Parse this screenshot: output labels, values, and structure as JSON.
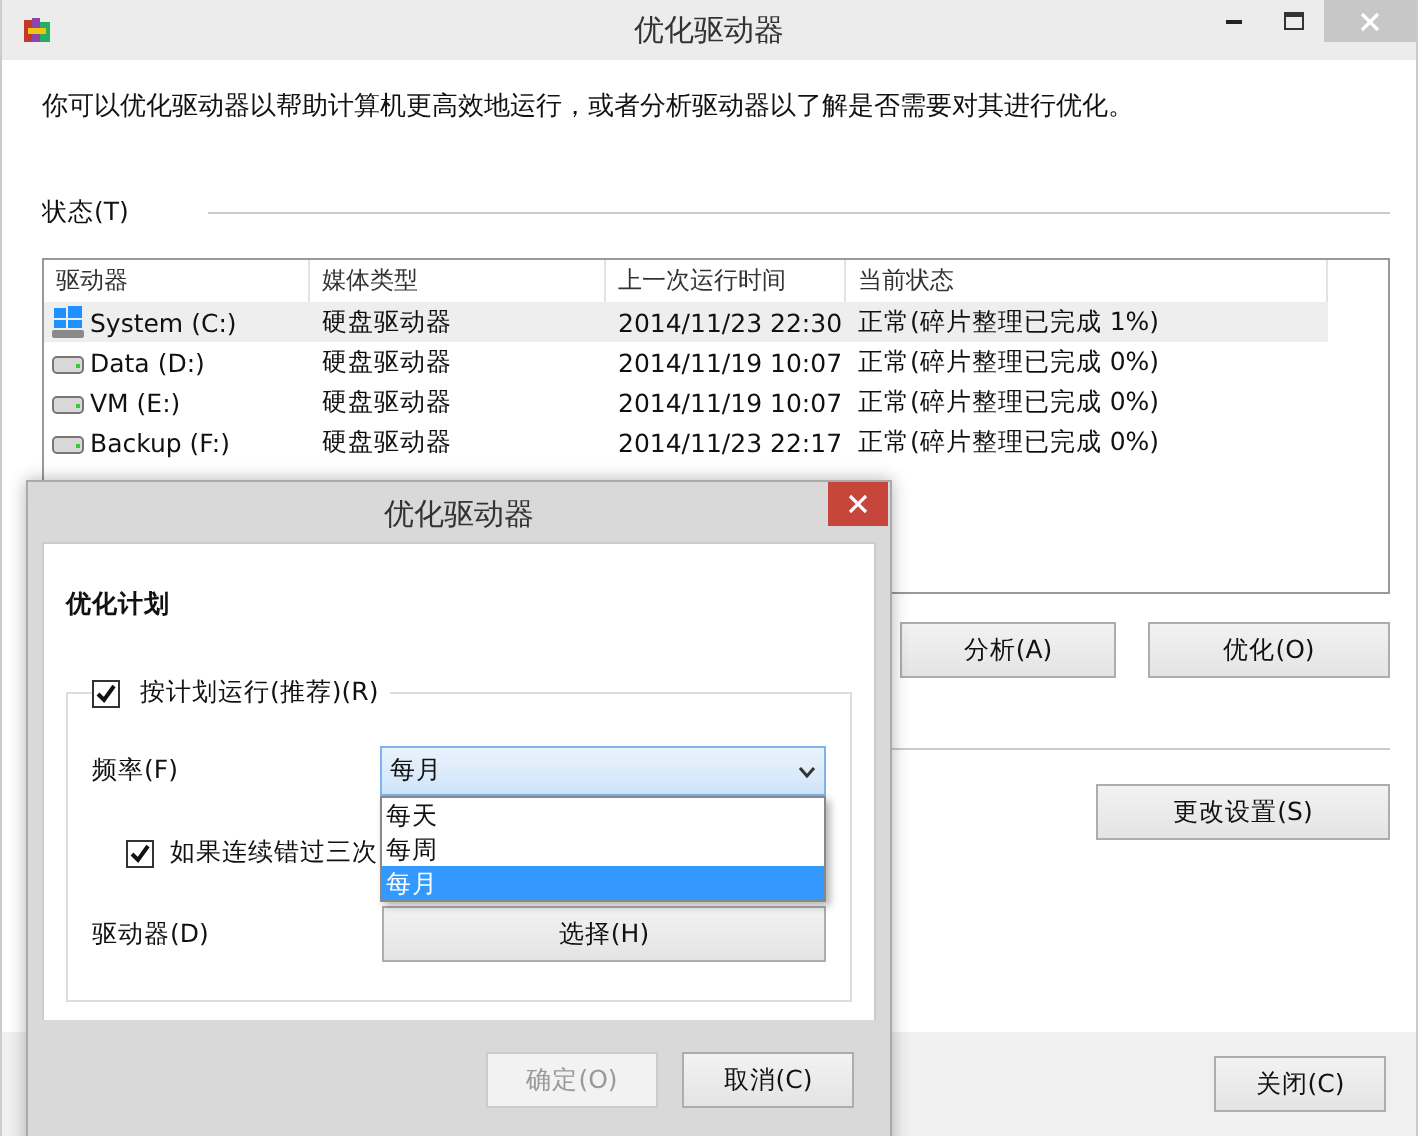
{
  "window": {
    "title": "优化驱动器"
  },
  "description": "你可以优化驱动器以帮助计算机更高效地运行，或者分析驱动器以了解是否需要对其进行优化。",
  "status_label": "状态(T)",
  "table": {
    "columns": [
      "驱动器",
      "媒体类型",
      "上一次运行时间",
      "当前状态"
    ],
    "rows": [
      {
        "drive": "System (C:)",
        "kind": "system",
        "media": "硬盘驱动器",
        "last_run": "2014/11/23 22:30",
        "status": "正常(碎片整理已完成 1%)",
        "selected": true
      },
      {
        "drive": "Data (D:)",
        "kind": "disk",
        "media": "硬盘驱动器",
        "last_run": "2014/11/19 10:07",
        "status": "正常(碎片整理已完成 0%)",
        "selected": false
      },
      {
        "drive": "VM (E:)",
        "kind": "disk",
        "media": "硬盘驱动器",
        "last_run": "2014/11/19 10:07",
        "status": "正常(碎片整理已完成 0%)",
        "selected": false
      },
      {
        "drive": "Backup (F:)",
        "kind": "disk",
        "media": "硬盘驱动器",
        "last_run": "2014/11/23 22:17",
        "status": "正常(碎片整理已完成 0%)",
        "selected": false
      }
    ]
  },
  "actions": [
    "分析(A)",
    "优化(O)"
  ],
  "change_settings": "更改设置(S)",
  "close_button": "关闭(C)",
  "dialog": {
    "title": "优化驱动器",
    "section_title": "优化计划",
    "schedule_checkbox": {
      "label": "按计划运行(推荐)(R)",
      "checked": true
    },
    "frequency": {
      "label": "频率(F)",
      "value": "每月",
      "expanded": true,
      "options": [
        {
          "label": "每天",
          "selected": false
        },
        {
          "label": "每周",
          "selected": false
        },
        {
          "label": "每月",
          "selected": true
        }
      ]
    },
    "missed_checkbox": {
      "label": "如果连续错过三次",
      "checked": true
    },
    "drives": {
      "label": "驱动器(D)",
      "button": "选择(H)"
    },
    "buttons": [
      {
        "label": "确定(O)",
        "disabled": true
      },
      {
        "label": "取消(C)",
        "disabled": false
      }
    ]
  }
}
